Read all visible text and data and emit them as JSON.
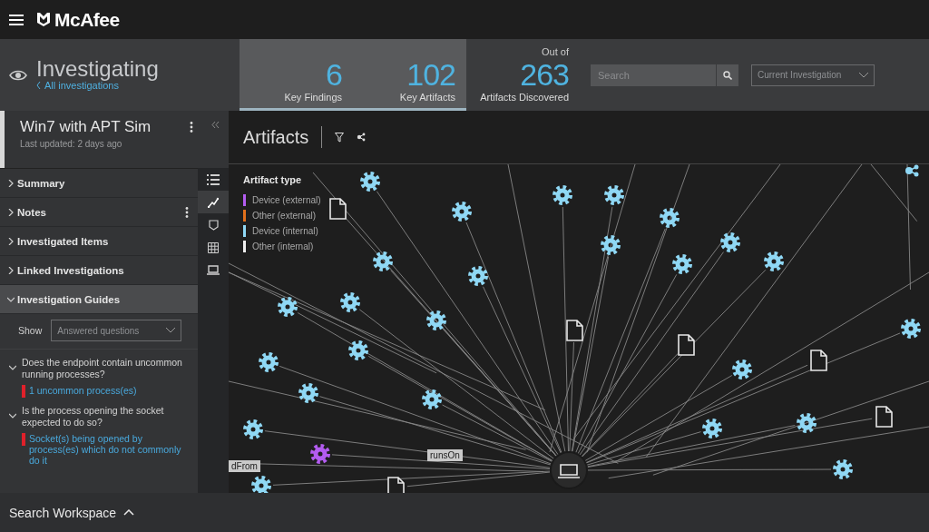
{
  "app": {
    "brand": "McAfee"
  },
  "header": {
    "title": "Investigating",
    "back_link": "All investigations",
    "stats": [
      {
        "value": "6",
        "label": "Key Findings",
        "highlighted": true
      },
      {
        "value": "102",
        "label": "Key Artifacts",
        "highlighted": true
      },
      {
        "value": "263",
        "label": "Artifacts Discovered",
        "caption": "Out of",
        "highlighted": false
      }
    ],
    "search": {
      "placeholder": "Search"
    },
    "scope_select": {
      "value": "Current Investigation"
    }
  },
  "investigation": {
    "title": "Win7 with APT Sim",
    "subtitle": "Last updated: 2 days ago"
  },
  "sections": [
    {
      "label": "Summary",
      "expanded": false,
      "has_menu": false
    },
    {
      "label": "Notes",
      "expanded": false,
      "has_menu": true
    },
    {
      "label": "Investigated Items",
      "expanded": false,
      "has_menu": false
    },
    {
      "label": "Linked Investigations",
      "expanded": false,
      "has_menu": false
    },
    {
      "label": "Investigation Guides",
      "expanded": true,
      "has_menu": false
    }
  ],
  "guides": {
    "show_label": "Show",
    "show_select": {
      "value": "Answered questions"
    },
    "questions": [
      {
        "text": "Does the endpoint contain uncommon running processes?",
        "expanded": true,
        "answer": "1 uncommon process(es)",
        "color": "#e0202a"
      },
      {
        "text": "Is the process opening the socket expected to do so?",
        "expanded": true,
        "answer": "Socket(s) being opened by process(es) which do not commonly do it",
        "color": "#e0202a"
      }
    ]
  },
  "views": [
    {
      "kind": "list",
      "selected": false
    },
    {
      "kind": "graph",
      "selected": true
    },
    {
      "kind": "shield",
      "selected": false
    },
    {
      "kind": "grid",
      "selected": false
    },
    {
      "kind": "laptop",
      "selected": false
    }
  ],
  "artifacts": {
    "title": "Artifacts",
    "legend_title": "Artifact type",
    "legend": [
      {
        "label": "Device (external)",
        "color": "#b35cf0"
      },
      {
        "label": "Other (external)",
        "color": "#e0701c"
      },
      {
        "label": "Device (internal)",
        "color": "#8fd8f5"
      },
      {
        "label": "Other (internal)",
        "color": "#eeeeee"
      }
    ],
    "edge_labels": [
      {
        "text": "runsOn"
      },
      {
        "text": "dFrom"
      }
    ]
  },
  "footer": {
    "label": "Search Workspace"
  }
}
